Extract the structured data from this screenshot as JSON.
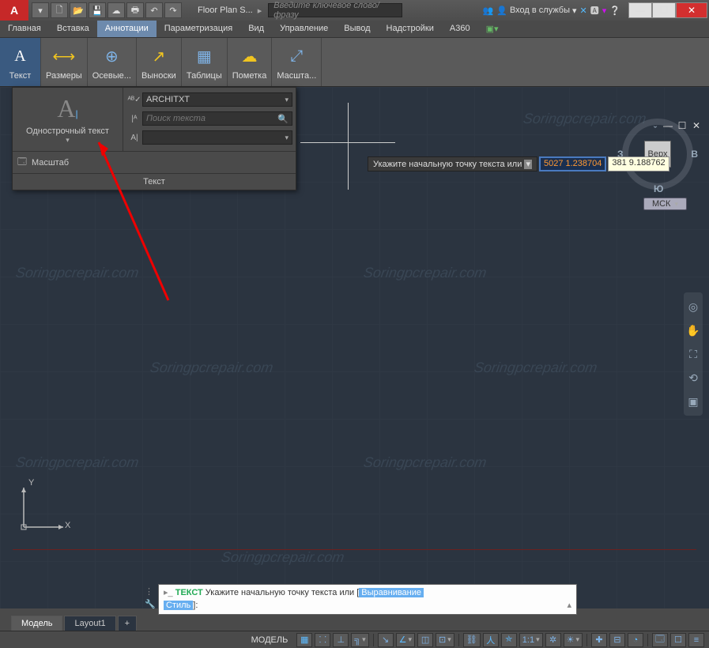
{
  "app": {
    "title": "Floor Plan S..."
  },
  "search": {
    "placeholder": "Введите ключевое слово/фразу"
  },
  "signin": {
    "text": "Вход в службы"
  },
  "menu": {
    "home": "Главная",
    "insert": "Вставка",
    "annotate": "Аннотации",
    "param": "Параметризация",
    "view": "Вид",
    "manage": "Управление",
    "output": "Вывод",
    "addins": "Надстройки",
    "a360": "A360"
  },
  "ribbon": {
    "text": "Текст",
    "dim": "Размеры",
    "center": "Осевые...",
    "leader": "Выноски",
    "table": "Таблицы",
    "markup": "Пометка",
    "scale": "Масшта..."
  },
  "panel": {
    "singleline": "Однострочный текст",
    "style_value": "ARCHITXT",
    "find_placeholder": "Поиск текста",
    "scale_label": "Масштаб",
    "footer": "Текст"
  },
  "dyninput": {
    "prompt": "Укажите начальную точку текста или",
    "coord": "5027  1.238704",
    "readout": "381  9.188762"
  },
  "viewcube": {
    "top": "Верх",
    "s": "Ю",
    "w": "З",
    "e": "В",
    "wcs": "МСК"
  },
  "cmdline": {
    "cmd": "ТЕКСТ",
    "prompt": "Укажите начальную точку текста или",
    "opt1": "Выравнивание",
    "opt2": "Стиль",
    "bracket_open": "[",
    "bracket_close": "]",
    "colon": ":"
  },
  "tabs": {
    "model": "Модель",
    "layout1": "Layout1",
    "plus": "+"
  },
  "status": {
    "model": "МОДЕЛЬ",
    "scale": "1:1"
  },
  "ucs": {
    "x": "X",
    "y": "Y"
  },
  "watermark": "Soringpcrepair.com"
}
